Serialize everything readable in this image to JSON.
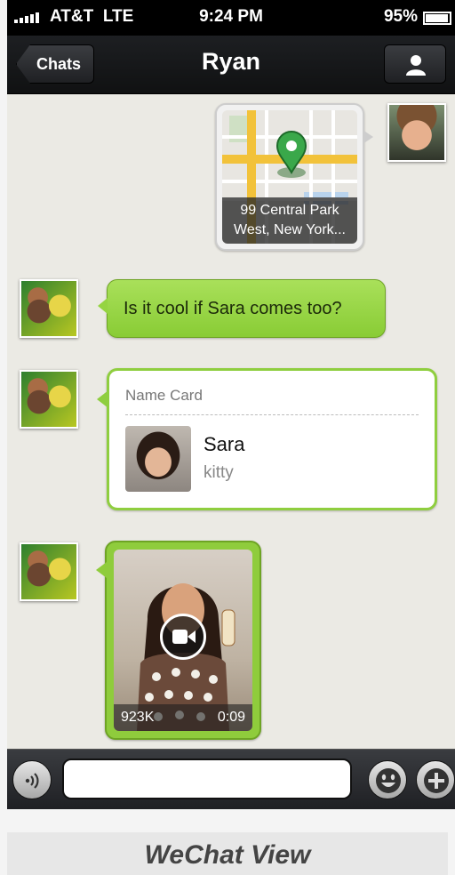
{
  "status_bar": {
    "carrier": "AT&T",
    "network": "LTE",
    "time": "9:24 PM",
    "battery": "95%",
    "battery_level": 0.95
  },
  "nav": {
    "back_label": "Chats",
    "title": "Ryan",
    "profile_icon": "person-icon"
  },
  "messages": {
    "location": {
      "line1": "99 Central Park",
      "line2": "West, New York..."
    },
    "text": "Is it cool if Sara comes too?",
    "name_card": {
      "header": "Name Card",
      "name": "Sara",
      "subtitle": "kitty"
    },
    "video": {
      "size": "923K",
      "duration": "0:09"
    }
  },
  "input_bar": {
    "placeholder": "",
    "voice_icon": "voice-icon",
    "emoji_icon": "smiley-icon",
    "plus_icon": "plus-icon"
  },
  "caption": "WeChat View",
  "colors": {
    "bubble_green": "#8fce3f",
    "nav_dark": "#1d1f22",
    "chat_bg": "#ebeae4"
  }
}
